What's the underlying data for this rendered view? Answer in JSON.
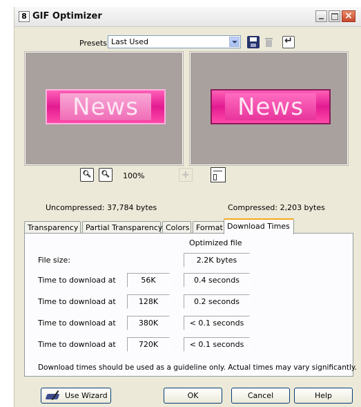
{
  "window": {
    "title": "GIF Optimizer",
    "icon_glyph": "8"
  },
  "presets": {
    "label": "Presets:",
    "value": "Last Used"
  },
  "preview": {
    "original_text": "News",
    "optimized_text": "News"
  },
  "zoom": {
    "level": "100%"
  },
  "stats": {
    "uncompressed": "Uncompressed:  37,784 bytes",
    "compressed": "Compressed: 2,203 bytes"
  },
  "tabs": [
    {
      "label": "Transparency"
    },
    {
      "label": "Partial Transparency"
    },
    {
      "label": "Colors"
    },
    {
      "label": "Format"
    },
    {
      "label": "Download Times",
      "active": true
    }
  ],
  "download": {
    "header": "Optimized file",
    "file_size_label": "File size:",
    "file_size": "2.2K bytes",
    "rows": [
      {
        "label": "Time to download at",
        "speed": "56K",
        "time": "0.4 seconds"
      },
      {
        "label": "Time to download at",
        "speed": "128K",
        "time": "0.2 seconds"
      },
      {
        "label": "Time to download at",
        "speed": "380K",
        "time": "< 0.1 seconds"
      },
      {
        "label": "Time to download at",
        "speed": "720K",
        "time": "< 0.1 seconds"
      }
    ],
    "note": "Download times should be used as a guideline only. Actual times may vary significantly."
  },
  "buttons": {
    "wizard": "Use Wizard",
    "ok": "OK",
    "cancel": "Cancel",
    "help": "Help"
  },
  "colors": {
    "accent_tab": "#f9a81c",
    "preview_bg": "#a9a19e",
    "banner_pink": "#e21b91"
  }
}
